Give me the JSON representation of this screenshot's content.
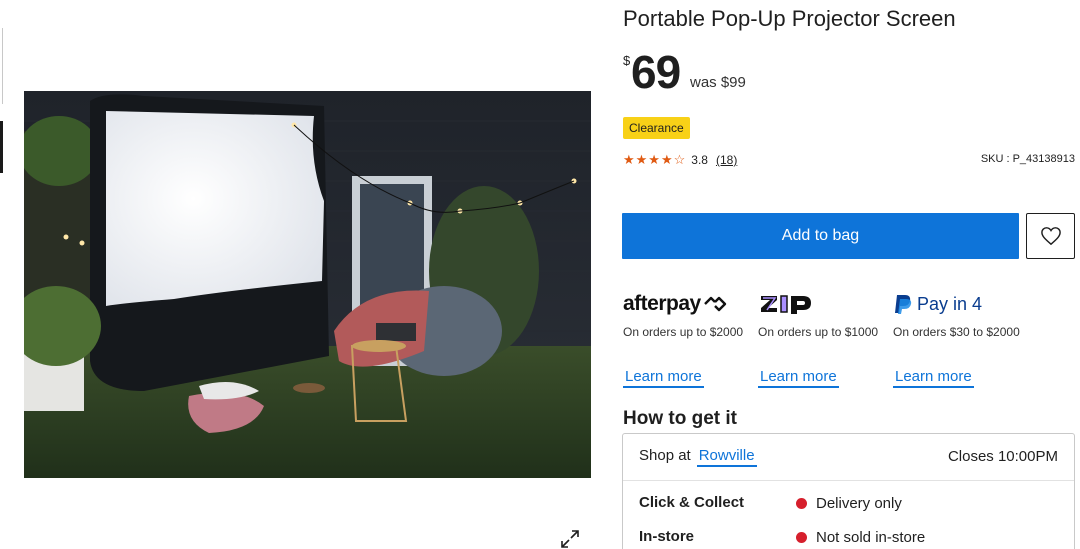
{
  "product": {
    "title": "Portable Pop-Up Projector Screen",
    "currency": "$",
    "price": "69",
    "was_price": "was $99",
    "badge": "Clearance",
    "rating_value": "3.8",
    "rating_count": "(18)",
    "rating_stars": 3.8,
    "sku": "SKU : P_43138913"
  },
  "actions": {
    "add_to_bag": "Add to bag"
  },
  "payments": [
    {
      "name": "afterpay",
      "logo_text": "afterpay",
      "desc": "On orders up to $2000",
      "link": "Learn more"
    },
    {
      "name": "zip",
      "logo_text": "zip",
      "desc": "On orders up to $1000",
      "link": "Learn more"
    },
    {
      "name": "paypal",
      "logo_text": "Pay in 4",
      "desc": "On orders $30 to $2000",
      "link": "Learn more"
    }
  ],
  "fulfilment": {
    "title": "How to get it",
    "shop_at_label": "Shop at",
    "store_name": "Rowville",
    "closes": "Closes 10:00PM",
    "options": [
      {
        "label": "Click & Collect",
        "status": "Delivery only"
      },
      {
        "label": "In-store",
        "status": "Not sold in-store"
      }
    ]
  },
  "colors": {
    "primary_blue": "#0e74d9",
    "clearance_yellow": "#f8d117",
    "star_orange": "#e05a12",
    "status_red": "#d61f2c",
    "zip_purple": "#aa8fff"
  },
  "icons": {
    "wishlist": "heart-icon",
    "expand": "expand-icon",
    "star": "star-icon"
  }
}
